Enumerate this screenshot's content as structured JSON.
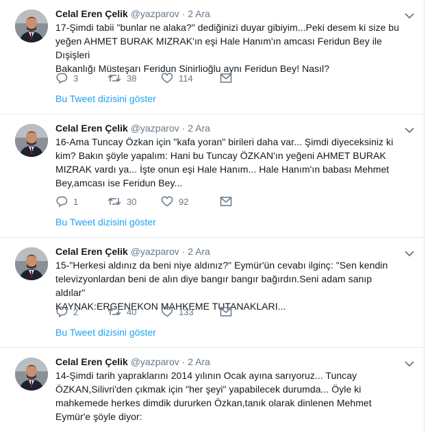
{
  "tweets": [
    {
      "fullname": "Celal Eren Çelik",
      "handle": "@yazparov",
      "dot": "·",
      "time": "2 Ara",
      "lines": [
        "17-Şimdi tabii \"bunlar ne alaka?\" dediğinizi duyar gibiyim...Peki desem ki size bu",
        "yeğen AHMET BURAK MIZRAK'ın eşi Hale Hanım'ın amcası Feridun Bey ile Dışişleri",
        "Bakanlığı Müsteşarı Feridun Sinirlioğlu aynı Feridun Bey! Nasıl?"
      ],
      "replies": "3",
      "retweets": "38",
      "likes": "114",
      "show_thread": "Bu Tweet dizisini göster"
    },
    {
      "fullname": "Celal Eren Çelik",
      "handle": "@yazparov",
      "dot": "·",
      "time": "2 Ara",
      "lines": [
        "16-Ama Tuncay Özkan için \"kafa yoran\" birileri daha var... Şimdi diyeceksiniz ki",
        "kim? Bakın şöyle yapalım: Hani bu Tuncay ÖZKAN'ın yeğeni AHMET BURAK",
        "MIZRAK vardı ya... İşte onun eşi Hale Hanım... Hale Hanım'ın babası Mehmet",
        "Bey,amcası ise Feridun Bey..."
      ],
      "replies": "1",
      "retweets": "30",
      "likes": "92",
      "show_thread": "Bu Tweet dizisini göster"
    },
    {
      "fullname": "Celal Eren Çelik",
      "handle": "@yazparov",
      "dot": "·",
      "time": "2 Ara",
      "lines": [
        "15-\"Herkesi aldınız da beni niye aldınız?\" Eymür'ün cevabı ilginç: \"Sen kendin",
        "televizyonlardan beni de alın diye bangır bangır bağırdın.Seni adam sanıp aldılar\"",
        "KAYNAK:ERGENEKON MAHKEME TUTANAKLARI..."
      ],
      "replies": "2",
      "retweets": "40",
      "likes": "133",
      "show_thread": "Bu Tweet dizisini göster"
    },
    {
      "fullname": "Celal Eren Çelik",
      "handle": "@yazparov",
      "dot": "·",
      "time": "2 Ara",
      "lines": [
        "14-Şimdi tarih yapraklarını 2014 yılının Ocak ayına sarıyoruz... Tuncay",
        "ÖZKAN,Silivri'den çıkmak için \"her şeyi\" yapabilecek durumda... Öyle ki",
        "mahkemede herkes dimdik dururken Özkan,tanık olarak dinlenen Mehmet",
        "Eymür'e şöyle diyor:"
      ]
    }
  ],
  "icons": {
    "reply": "reply-icon",
    "retweet": "retweet-icon",
    "like": "heart-icon",
    "dm": "envelope-icon",
    "caret": "chevron-down-icon"
  },
  "colors": {
    "link": "#1da1f2",
    "secondary": "#657786",
    "text": "#14171a",
    "border": "#e6ecf0"
  }
}
